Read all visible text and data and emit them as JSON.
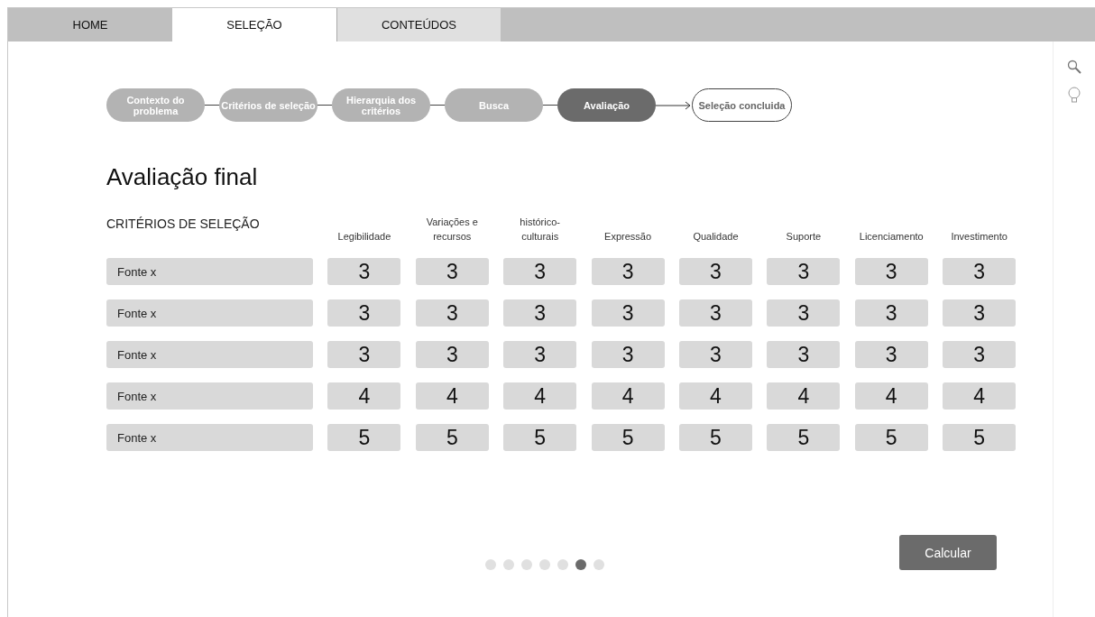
{
  "tabs": [
    {
      "label": "HOME",
      "selected": false,
      "hovered": false
    },
    {
      "label": "SELEÇÃO",
      "selected": true,
      "hovered": false
    },
    {
      "label": "CONTEÚDOS",
      "selected": false,
      "hovered": true
    }
  ],
  "steps": [
    {
      "label": "Contexto do problema",
      "kind": "done"
    },
    {
      "label": "Critérios de seleção",
      "kind": "done"
    },
    {
      "label": "Hierarquia dos critérios",
      "kind": "done"
    },
    {
      "label": "Busca",
      "kind": "done"
    },
    {
      "label": "Avaliação",
      "kind": "current"
    },
    {
      "label": "Seleção concluida",
      "kind": "pending"
    }
  ],
  "title": "Avaliação final",
  "table": {
    "corner": "CRITÉRIOS DE SELEÇÃO",
    "columns": [
      "Legibilidade",
      "Variações e recursos",
      "histórico-culturais",
      "Expressão",
      "Qualidade",
      "Suporte",
      "Licenciamento",
      "Investimento"
    ],
    "rows": [
      {
        "name": "Fonte x",
        "scores": [
          "3",
          "3",
          "3",
          "3",
          "3",
          "3",
          "3",
          "3"
        ]
      },
      {
        "name": "Fonte x",
        "scores": [
          "3",
          "3",
          "3",
          "3",
          "3",
          "3",
          "3",
          "3"
        ]
      },
      {
        "name": "Fonte x",
        "scores": [
          "3",
          "3",
          "3",
          "3",
          "3",
          "3",
          "3",
          "3"
        ]
      },
      {
        "name": "Fonte x",
        "scores": [
          "4",
          "4",
          "4",
          "4",
          "4",
          "4",
          "4",
          "4"
        ]
      },
      {
        "name": "Fonte x",
        "scores": [
          "5",
          "5",
          "5",
          "5",
          "5",
          "5",
          "5",
          "5"
        ]
      }
    ]
  },
  "pager": [
    {
      "selected": false
    },
    {
      "selected": false
    },
    {
      "selected": false
    },
    {
      "selected": false
    },
    {
      "selected": false
    },
    {
      "selected": true
    },
    {
      "selected": false
    }
  ],
  "button": "Calcular"
}
